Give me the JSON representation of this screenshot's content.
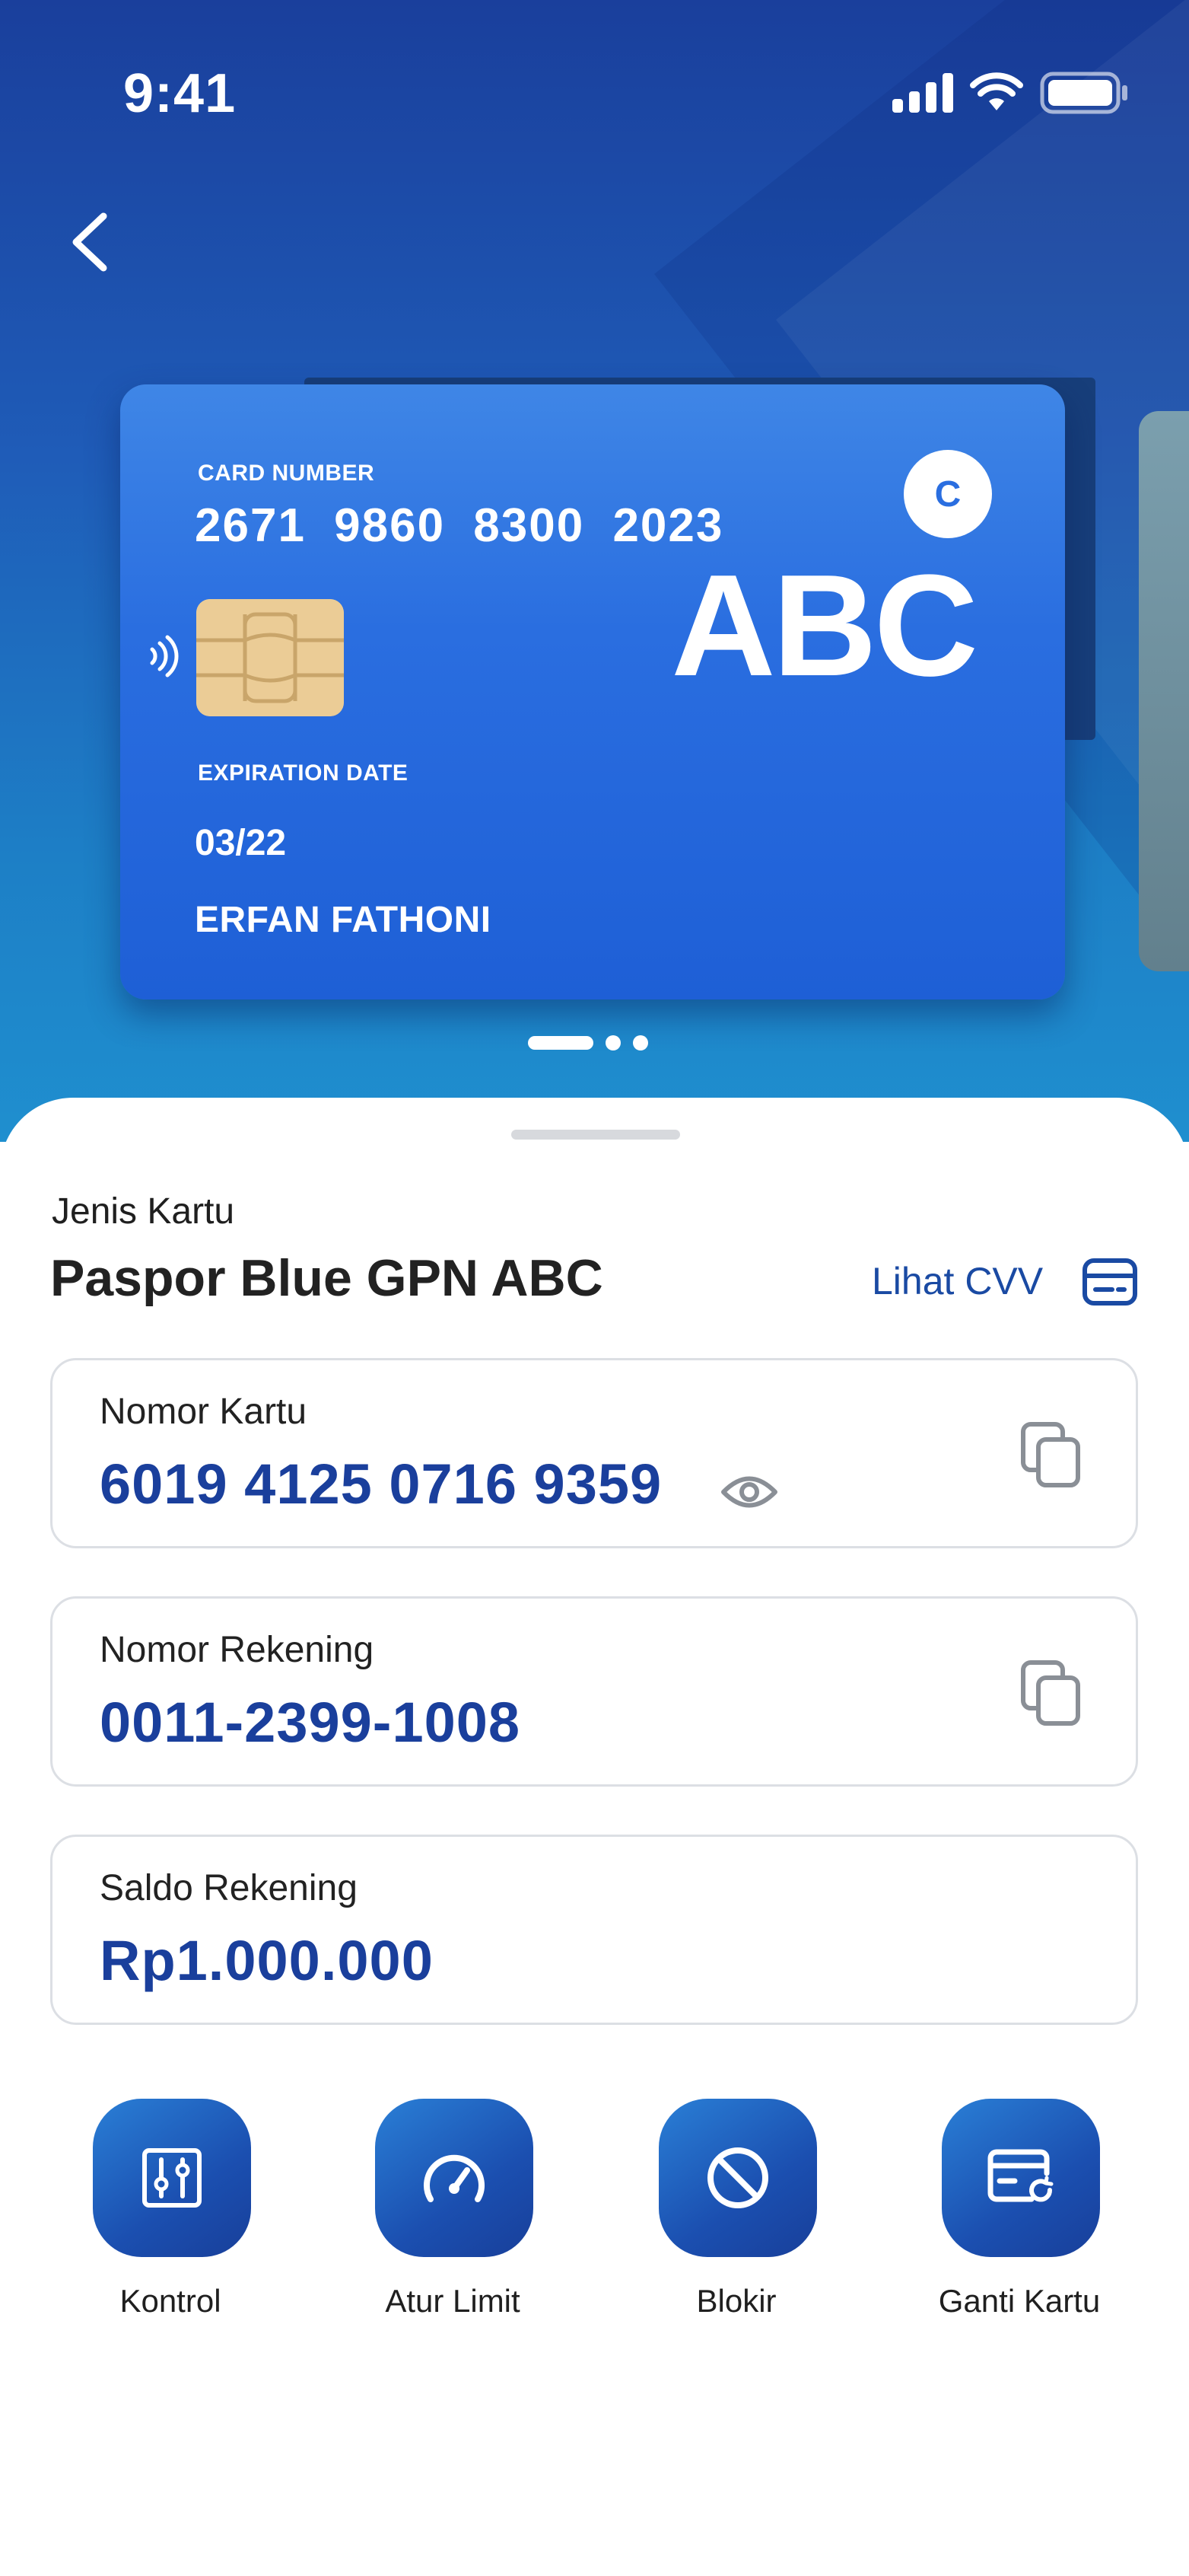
{
  "status_bar": {
    "time": "9:41"
  },
  "card": {
    "number_label": "CARD NUMBER",
    "number": "2671 9860 8300 2023",
    "brand": "ABC",
    "logo_letter": "C",
    "expiry_label": "EXPIRATION DATE",
    "expiry": "03/22",
    "holder": "ERFAN FATHONI"
  },
  "pagination": {
    "total": 3,
    "active": 0
  },
  "sheet": {
    "type_label": "Jenis Kartu",
    "type_name": "Paspor Blue GPN ABC",
    "cvv_link": "Lihat CVV",
    "fields": [
      {
        "label": "Nomor Kartu",
        "value": "6019 4125 0716 9359"
      },
      {
        "label": "Nomor Rekening",
        "value": "0011-2399-1008"
      },
      {
        "label": "Saldo Rekening",
        "value": "Rp1.000.000"
      }
    ]
  },
  "actions": [
    {
      "label": "Kontrol",
      "icon": "sliders-icon"
    },
    {
      "label": "Atur Limit",
      "icon": "speedometer-icon"
    },
    {
      "label": "Blokir",
      "icon": "block-icon"
    },
    {
      "label": "Ganti Kartu",
      "icon": "card-replace-icon"
    }
  ],
  "colors": {
    "primary": "#1a3f9c",
    "link": "#1a4aa3",
    "card": "#2a6ee0",
    "border": "#dcdfe4"
  }
}
